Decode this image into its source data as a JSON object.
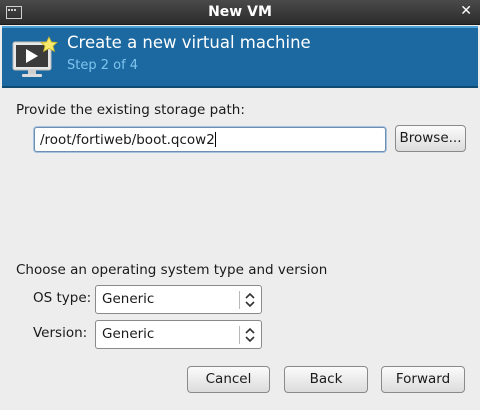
{
  "window": {
    "title": "New VM",
    "close_label": "✕"
  },
  "header": {
    "title": "Create a new virtual machine",
    "step": "Step 2 of 4",
    "icon": "vm-monitor-star-icon"
  },
  "storage": {
    "label": "Provide the existing storage path:",
    "path_value": "/root/fortiweb/boot.qcow2",
    "browse_label": "Browse..."
  },
  "os": {
    "section_label": "Choose an operating system type and version",
    "type_label": "OS type:",
    "type_value": "Generic",
    "version_label": "Version:",
    "version_value": "Generic"
  },
  "buttons": {
    "cancel": "Cancel",
    "back": "Back",
    "forward": "Forward"
  },
  "colors": {
    "banner": "#1b69a0",
    "step_text": "#7fc4ef",
    "titlebar": "#2c2c2c"
  }
}
